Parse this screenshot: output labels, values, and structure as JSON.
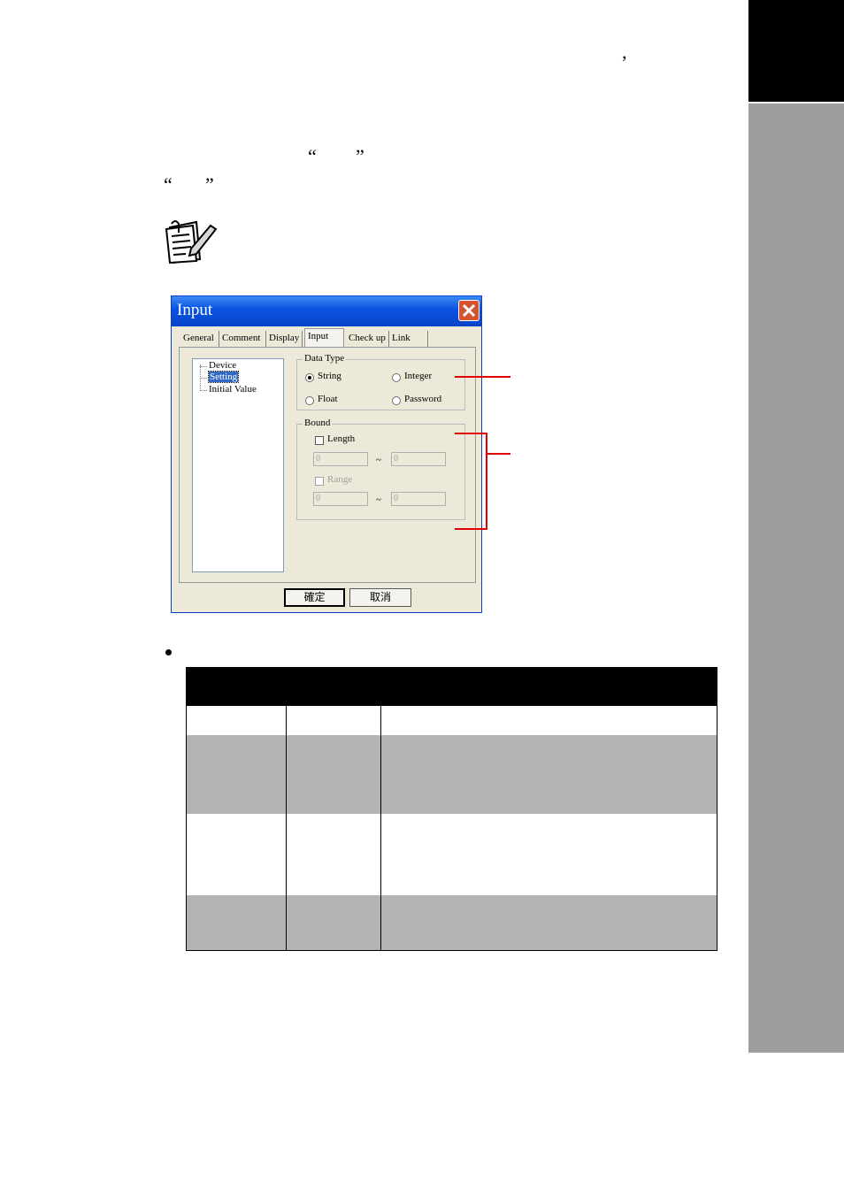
{
  "page": {
    "punctuation": {
      "comma": "’",
      "quote_open": "“",
      "quote_close": "”"
    }
  },
  "note": {
    "icon": "note-pencil-icon"
  },
  "dialog": {
    "title": "Input",
    "close_icon": "close-icon",
    "tabs": [
      {
        "label": "General"
      },
      {
        "label": "Comment"
      },
      {
        "label": "Display"
      },
      {
        "label": "Input"
      },
      {
        "label": "Check up"
      },
      {
        "label": "Link"
      }
    ],
    "active_tab": "Input",
    "tree": [
      {
        "label": "Device"
      },
      {
        "label": "Setting"
      },
      {
        "label": "Initial Value"
      }
    ],
    "selected_tree_item": "Setting",
    "data_type": {
      "label": "Data Type",
      "options": [
        {
          "label": "String"
        },
        {
          "label": "Integer"
        },
        {
          "label": "Float"
        },
        {
          "label": "Password"
        }
      ],
      "selected": "String"
    },
    "bound": {
      "label": "Bound",
      "length_label": "Length",
      "length_min": "0",
      "length_max": "0",
      "range_label": "Range",
      "range_min": "0",
      "range_max": "0",
      "tilde": "~"
    },
    "ok_label": "確定",
    "cancel_label": "取消"
  },
  "colors": {
    "annotation_red": "#e00000",
    "sidebar_black": "#000000",
    "sidebar_gray": "#9e9e9e",
    "table_header": "#000000",
    "table_shaded_row": "#b3b3b3"
  }
}
